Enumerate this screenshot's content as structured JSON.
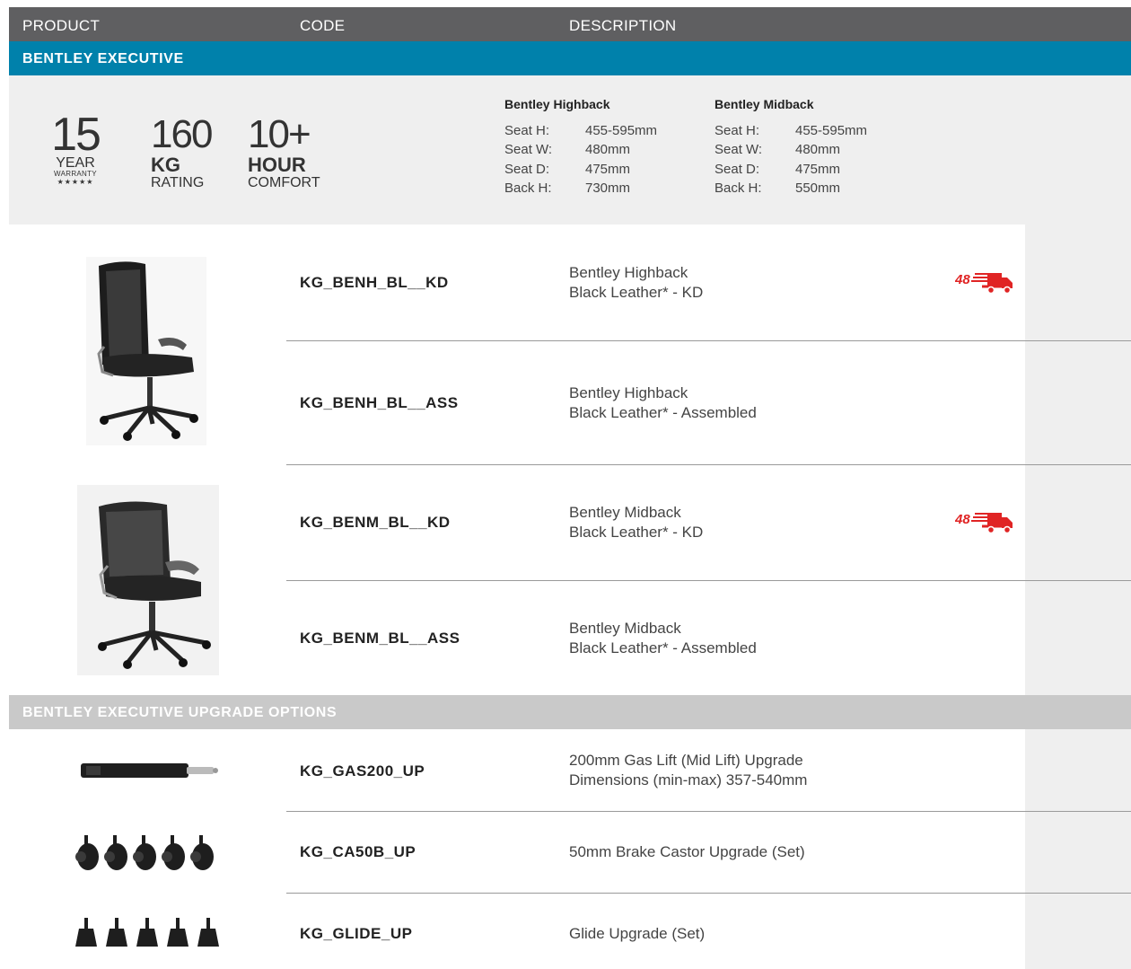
{
  "header": {
    "product": "PRODUCT",
    "code": "CODE",
    "description": "DESCRIPTION"
  },
  "section_title": "BENTLEY EXECUTIVE",
  "stats": {
    "warranty": {
      "value": "15",
      "line1": "YEAR",
      "line2": "WARRANTY",
      "stars": "★★★★★"
    },
    "rating": {
      "value": "160",
      "unit": "KG",
      "label": "RATING"
    },
    "comfort": {
      "value": "10+",
      "unit": "HOUR",
      "label": "COMFORT"
    }
  },
  "specs": [
    {
      "title": "Bentley Highback",
      "rows": [
        {
          "label": "Seat H:",
          "value": "455-595mm"
        },
        {
          "label": "Seat W:",
          "value": "480mm"
        },
        {
          "label": "Seat D:",
          "value": "475mm"
        },
        {
          "label": "Back H:",
          "value": "730mm"
        }
      ]
    },
    {
      "title": "Bentley Midback",
      "rows": [
        {
          "label": "Seat H:",
          "value": "455-595mm"
        },
        {
          "label": "Seat W:",
          "value": "480mm"
        },
        {
          "label": "Seat D:",
          "value": "475mm"
        },
        {
          "label": "Back H:",
          "value": "550mm"
        }
      ]
    }
  ],
  "products": [
    {
      "code": "KG_BENH_BL__KD",
      "desc1": "Bentley Highback",
      "desc2": "Black Leather* - KD",
      "badge": "48"
    },
    {
      "code": "KG_BENH_BL__ASS",
      "desc1": "Bentley Highback",
      "desc2": "Black Leather* - Assembled"
    },
    {
      "code": "KG_BENM_BL__KD",
      "desc1": "Bentley Midback",
      "desc2": "Black Leather* - KD",
      "badge": "48"
    },
    {
      "code": "KG_BENM_BL__ASS",
      "desc1": "Bentley Midback",
      "desc2": "Black Leather* - Assembled"
    }
  ],
  "upgrade_title": "BENTLEY EXECUTIVE UPGRADE OPTIONS",
  "upgrades": [
    {
      "code": "KG_GAS200_UP",
      "desc1": "200mm Gas Lift (Mid Lift) Upgrade",
      "desc2": "Dimensions (min-max) 357-540mm"
    },
    {
      "code": "KG_CA50B_UP",
      "desc1": "50mm Brake Castor Upgrade (Set)"
    },
    {
      "code": "KG_GLIDE_UP",
      "desc1": "Glide Upgrade (Set)"
    }
  ],
  "colors": {
    "header": "#5f5f61",
    "section": "#0081ab",
    "upgrade_band": "#c9c9c9",
    "badge": "#e02424"
  }
}
